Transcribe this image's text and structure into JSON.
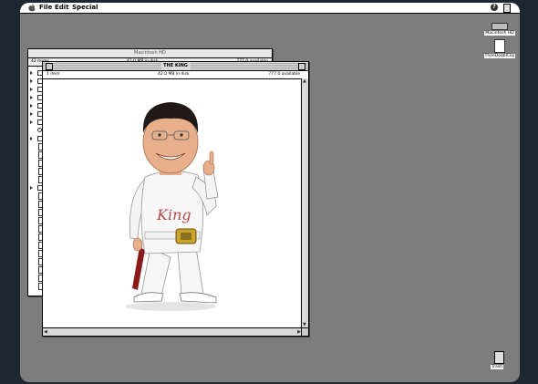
{
  "menubar": {
    "items": [
      "File",
      "Edit",
      "Special"
    ],
    "help_icon": "question-mark-help-icon",
    "app_icon": "finder-app-icon"
  },
  "desktop": {
    "icons": [
      {
        "label": "Macintosh HD",
        "icon": "hard-disk-icon"
      },
      {
        "label": "TheeDooblClip",
        "icon": "document-icon"
      }
    ],
    "trash_label": "Trash"
  },
  "back_window": {
    "title": "Macintosh HD",
    "items_count": "42 items",
    "disk_info": "42.0 MB in disk",
    "available": "777.0 available"
  },
  "front_window": {
    "title": "THE KING",
    "items_count": "1 item",
    "disk_info": "42.0 MB in disk",
    "available": "777.0 available",
    "image_text": "King"
  }
}
